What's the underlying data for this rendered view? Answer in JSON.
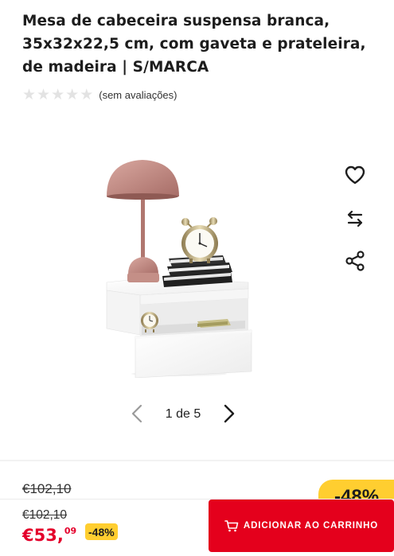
{
  "product": {
    "title": "Mesa de cabeceira suspensa branca, 35x32x22,5 cm, com gaveta e prateleira, de madeira | S/MARCA",
    "rating": {
      "stars_filled": 0,
      "stars_total": 5,
      "reviews_text": "(sem avaliações)"
    }
  },
  "gallery": {
    "image_alt": "Mesa de cabeceira suspensa branca com candeeiro rosa, despertador e livros",
    "current": "1",
    "total": "5",
    "counter_text": "1 de 5"
  },
  "actions": {
    "favorite_icon": "heart-icon",
    "compare_icon": "compare-arrows-icon",
    "share_icon": "share-icon"
  },
  "pricing": {
    "old_price": "€102,10",
    "price_main": "€53,",
    "price_cents": "09",
    "discount": "-48%",
    "discount_large": "-48%"
  },
  "cart": {
    "label": "ADICIONAR AO CARRINHO",
    "icon": "cart-icon"
  },
  "colors": {
    "accent_red": "#e4001c",
    "price_red": "#e4002b",
    "badge_yellow": "#ffce30",
    "star_empty": "#e3e3e3"
  }
}
